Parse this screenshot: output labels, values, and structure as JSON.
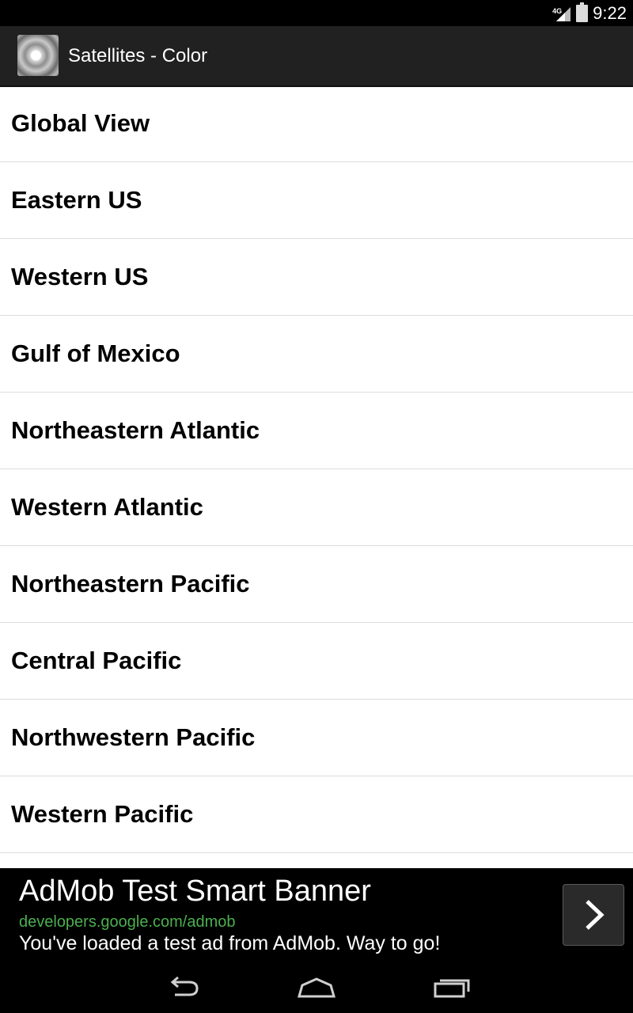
{
  "status_bar": {
    "time": "9:22",
    "network": "4G",
    "icons": [
      "signal-icon",
      "battery-icon"
    ]
  },
  "action_bar": {
    "title": "Satellites - Color",
    "icon": "hurricane-satellite-icon"
  },
  "regions": [
    {
      "label": "Global View"
    },
    {
      "label": "Eastern US"
    },
    {
      "label": "Western US"
    },
    {
      "label": "Gulf of Mexico"
    },
    {
      "label": "Northeastern Atlantic"
    },
    {
      "label": "Western Atlantic"
    },
    {
      "label": "Northeastern Pacific"
    },
    {
      "label": "Central Pacific"
    },
    {
      "label": "Northwestern Pacific"
    },
    {
      "label": "Western Pacific"
    }
  ],
  "ad": {
    "title": "AdMob Test Smart Banner",
    "url": "developers.google.com/admob",
    "description": "You've loaded a test ad from AdMob. Way to go!",
    "arrow_icon": "chevron-right-icon"
  },
  "nav_bar": {
    "icons": [
      "back-icon",
      "home-icon",
      "recent-apps-icon"
    ]
  },
  "colors": {
    "status_bar": "#000000",
    "action_bar": "#212121",
    "list_background": "#ffffff",
    "divider": "#dcdcdc",
    "ad_link": "#4caf50"
  }
}
